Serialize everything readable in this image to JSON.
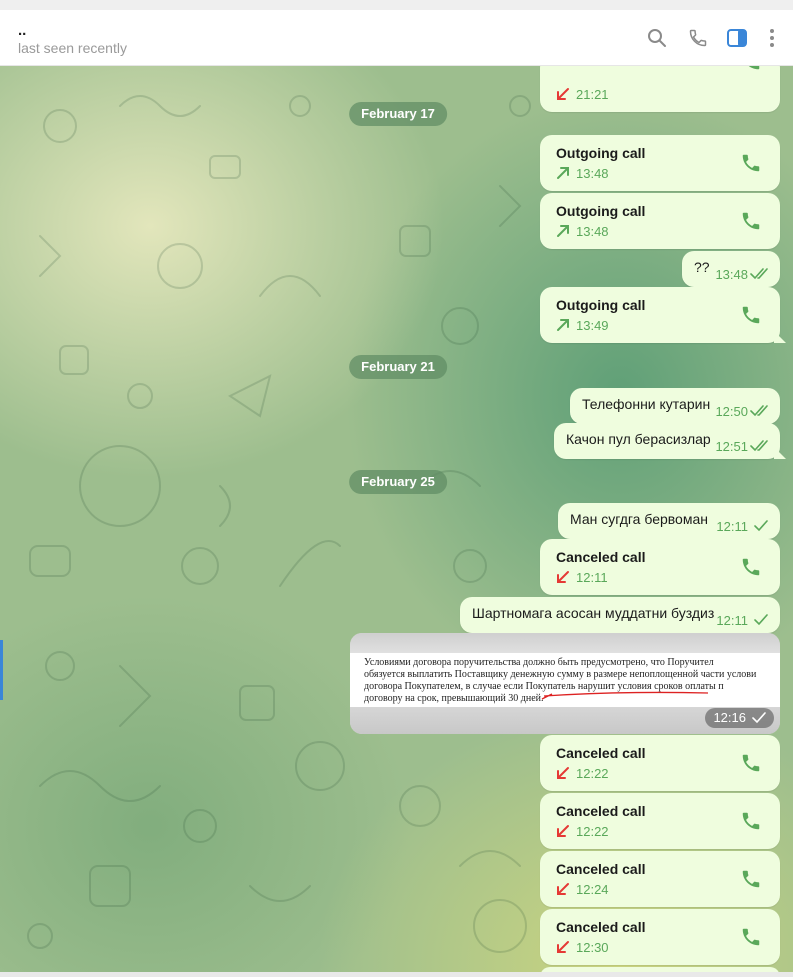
{
  "header": {
    "name": "..",
    "status": "last seen recently",
    "icons": [
      "search-icon",
      "phone-icon",
      "sidebar-toggle-icon",
      "more-icon"
    ]
  },
  "dates": {
    "feb17": "February 17",
    "feb21": "February 21",
    "feb25": "February 25"
  },
  "messages": {
    "m0": {
      "time": "21:21"
    },
    "m1": {
      "title": "Outgoing call",
      "time": "13:48"
    },
    "m2": {
      "title": "Outgoing call",
      "time": "13:48"
    },
    "m3": {
      "text": "??",
      "time": "13:48"
    },
    "m4": {
      "title": "Outgoing call",
      "time": "13:49"
    },
    "m5": {
      "text": "Телефонни кутарин",
      "time": "12:50"
    },
    "m6": {
      "text": "Качон пул берасизлар",
      "time": "12:51"
    },
    "m7": {
      "text": "Ман сугдга бервоман",
      "time": "12:11"
    },
    "m8": {
      "title": "Canceled call",
      "time": "12:11"
    },
    "m9": {
      "text": "Шартномага асосан муддатни буздиз",
      "time": "12:11"
    },
    "m10": {
      "time": "12:16",
      "lines": [
        "Условиями договора поручительства должно быть предусмотрено, что Поручител",
        "обязуется выплатить Поставщику денежную сумму в размере непоплощенной части услови",
        "договора Покупателем, в случае если Покупатель нарушит условия сроков оплаты п",
        "договору на срок, превышающий 30 дней."
      ]
    },
    "m11": {
      "title": "Canceled call",
      "time": "12:22"
    },
    "m12": {
      "title": "Canceled call",
      "time": "12:22"
    },
    "m13": {
      "title": "Canceled call",
      "time": "12:24"
    },
    "m14": {
      "title": "Canceled call",
      "time": "12:30"
    }
  },
  "colors": {
    "bubble": "#effdde",
    "accent_green": "#5aa85a",
    "missed_red": "#e53935",
    "header_active_icon": "#3a86d8"
  }
}
